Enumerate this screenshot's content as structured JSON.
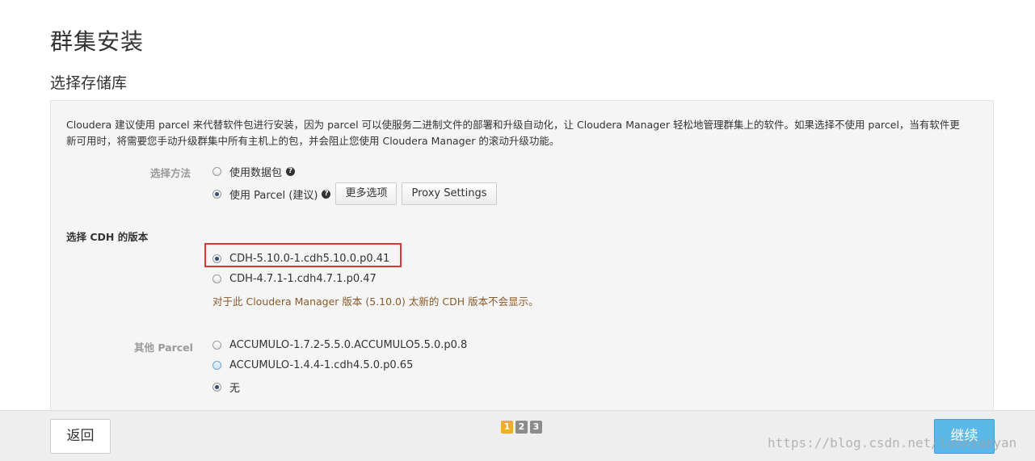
{
  "header": {
    "title": "群集安装",
    "subtitle": "选择存储库"
  },
  "panel": {
    "intro": "Cloudera 建议使用 parcel 来代替软件包进行安装，因为 parcel 可以使服务二进制文件的部署和升级自动化，让 Cloudera Manager 轻松地管理群集上的软件。如果选择不使用 parcel，当有软件更新可用时，将需要您手动升级群集中所有主机上的包，并会阻止您使用 Cloudera Manager 的滚动升级功能。",
    "method": {
      "label": "选择方法",
      "options": [
        {
          "label": "使用数据包",
          "checked": false
        },
        {
          "label": "使用 Parcel (建议)",
          "checked": true
        }
      ],
      "more_options": "更多选项",
      "proxy_settings": "Proxy Settings"
    },
    "cdh": {
      "label": "选择 CDH 的版本",
      "options": [
        {
          "label": "CDH-5.10.0-1.cdh5.10.0.p0.41",
          "checked": true
        },
        {
          "label": "CDH-4.7.1-1.cdh4.7.1.p0.47",
          "checked": false
        }
      ],
      "warning": "对于此 Cloudera Manager 版本 (5.10.0) 太新的 CDH 版本不会显示。"
    },
    "other": {
      "label": "其他 Parcel",
      "options": [
        {
          "label": "ACCUMULO-1.7.2-5.5.0.ACCUMULO5.5.0.p0.8",
          "checked": false
        },
        {
          "label": "ACCUMULO-1.4.4-1.cdh4.5.0.p0.65",
          "checked": false
        },
        {
          "label": "无",
          "checked": true
        }
      ]
    }
  },
  "footer": {
    "back": "返回",
    "continue": "继续",
    "pages": [
      "1",
      "2",
      "3"
    ],
    "current_page": "1"
  },
  "watermark": "https://blog.csdn.net/luoxiaoyan"
}
